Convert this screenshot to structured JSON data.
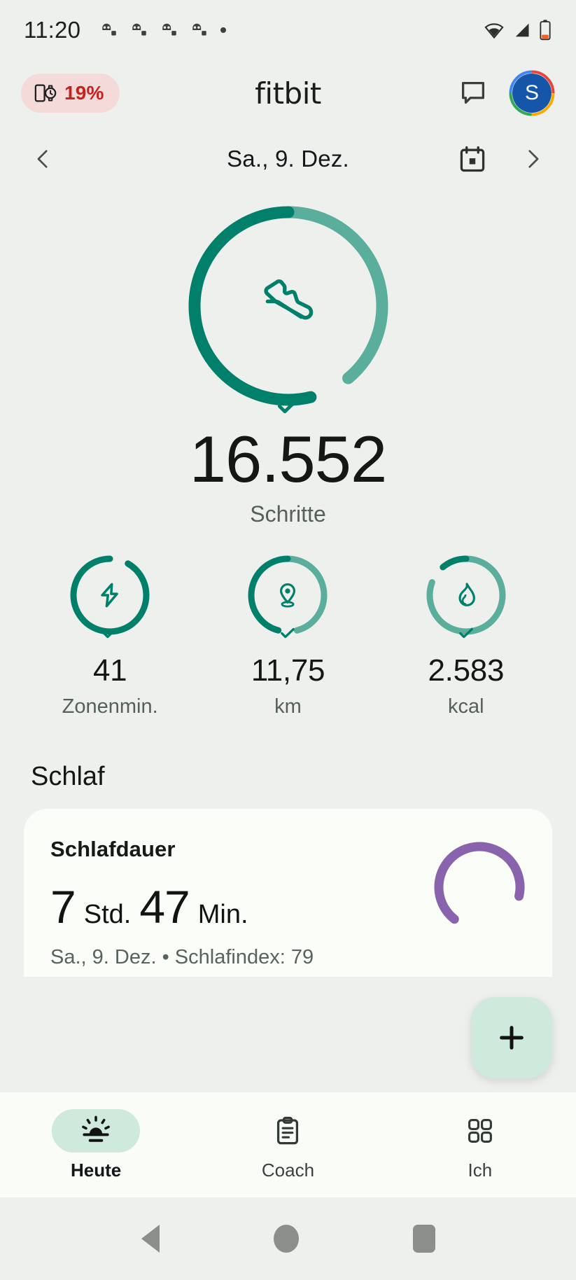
{
  "status_bar": {
    "time": "11:20",
    "notification_icons": [
      "app-notification-icon",
      "app-notification-icon",
      "app-notification-icon",
      "app-notification-icon"
    ],
    "dot_icon": "more-notifications-dot",
    "wifi_icon": "wifi-icon",
    "signal_icon": "cellular-signal-icon",
    "battery_icon": "battery-low-icon"
  },
  "app_bar": {
    "device_battery": {
      "icon": "watch-battery-icon",
      "percent": "19%"
    },
    "brand": "fitbit",
    "chat_icon": "chat-bubble-icon",
    "avatar_initial": "S",
    "avatar_ring_colors": [
      "#e8453c",
      "#f9ab00",
      "#34a853",
      "#4285f4"
    ],
    "avatar_bg": "#1656a8"
  },
  "date_nav": {
    "prev_icon": "chevron-left-icon",
    "date": "Sa., 9. Dez.",
    "calendar_icon": "calendar-icon",
    "next_icon": "chevron-right-icon"
  },
  "steps": {
    "icon": "shoe-icon",
    "value": "16.552",
    "label": "Schritte",
    "check_icon": "goal-reached-check-icon",
    "progress_color": "#00806b",
    "excess_color": "#5aae9b",
    "progress_percent": 58,
    "excess_percent": 42
  },
  "sub_metrics": [
    {
      "icon": "zone-minutes-icon",
      "value": "41",
      "label": "Zonenmin.",
      "check_icon": "goal-reached-check-icon",
      "progress_percent": 100,
      "excess_percent": 0
    },
    {
      "icon": "location-pin-icon",
      "value": "11,75",
      "label": "km",
      "check_icon": "goal-reached-check-icon",
      "progress_percent": 50,
      "excess_percent": 50
    },
    {
      "icon": "flame-icon",
      "value": "2.583",
      "label": "kcal",
      "check_icon": "goal-reached-check-icon",
      "progress_percent": 12,
      "excess_percent": 88
    }
  ],
  "sleep": {
    "section_title": "Schlaf",
    "card_title": "Schlafdauer",
    "hours": "7",
    "hours_unit": "Std.",
    "minutes": "47",
    "minutes_unit": "Min.",
    "subtitle": "Sa., 9. Dez. • Schlafindex: 79",
    "ring_color": "#8963ae",
    "ring_percent": 79
  },
  "fab": {
    "icon": "plus-icon",
    "bg": "#cfe9dd"
  },
  "bottom_nav": [
    {
      "icon": "sunrise-icon",
      "label": "Heute",
      "active": true
    },
    {
      "icon": "clipboard-icon",
      "label": "Coach",
      "active": false
    },
    {
      "icon": "grid-icon",
      "label": "Ich",
      "active": false
    }
  ],
  "system_nav": {
    "back_icon": "system-back-icon",
    "home_icon": "system-home-icon",
    "recents_icon": "system-recents-icon"
  }
}
